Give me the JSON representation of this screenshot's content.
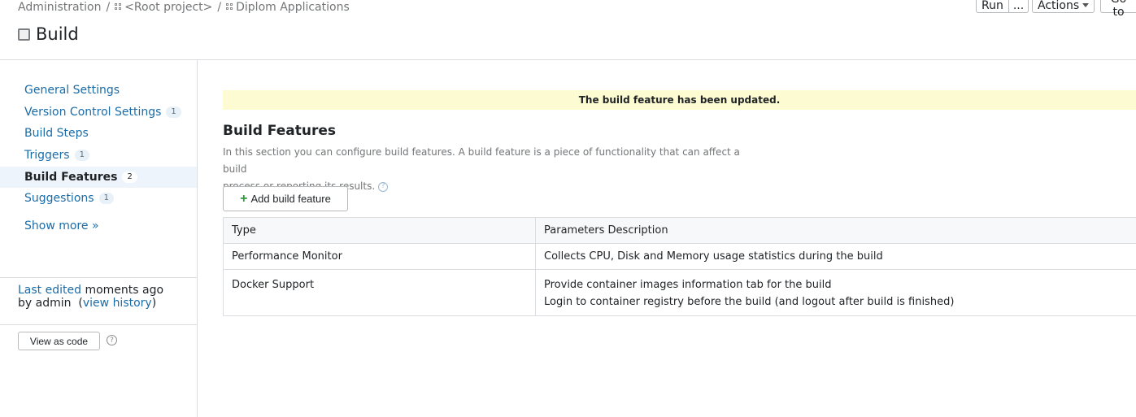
{
  "breadcrumb": {
    "items": [
      "Administration",
      "<Root project>",
      "Diplom Applications"
    ],
    "separator": "/"
  },
  "page": {
    "title": "Build"
  },
  "top_actions": {
    "run": "Run",
    "more": "...",
    "actions": "Actions",
    "goto": "Go to"
  },
  "sidebar": {
    "items": [
      {
        "label": "General Settings",
        "count": ""
      },
      {
        "label": "Version Control Settings",
        "count": "1"
      },
      {
        "label": "Build Steps",
        "count": ""
      },
      {
        "label": "Triggers",
        "count": "1"
      },
      {
        "label": "Build Features",
        "count": "2"
      },
      {
        "label": "Suggestions",
        "count": "1"
      }
    ],
    "show_more": "Show more »",
    "last_edited_prefix": "Last edited",
    "last_edited_when": "moments ago",
    "last_edited_by": "by admin",
    "view_history": "view history",
    "view_as_code": "View as code"
  },
  "main": {
    "notice": "The build feature has been updated.",
    "section_title": "Build Features",
    "section_desc_line1": "In this section you can configure build features. A build feature is a piece of functionality that can affect a build",
    "section_desc_line2": "process or reporting its results.",
    "add_button": "Add build feature",
    "table": {
      "headers": [
        "Type",
        "Parameters Description"
      ],
      "rows": [
        {
          "type": "Performance Monitor",
          "desc": [
            "Collects CPU, Disk and Memory usage statistics during the build"
          ]
        },
        {
          "type": "Docker Support",
          "desc": [
            "Provide container images information tab for the build",
            "Login to container registry before the build (and logout after build is finished)"
          ]
        }
      ]
    }
  },
  "colors": {
    "link": "#1a6ca8",
    "notice_bg": "#fdfbd2",
    "active_nav_bg": "#eef4fb",
    "plus_green": "#2e9a3c"
  }
}
